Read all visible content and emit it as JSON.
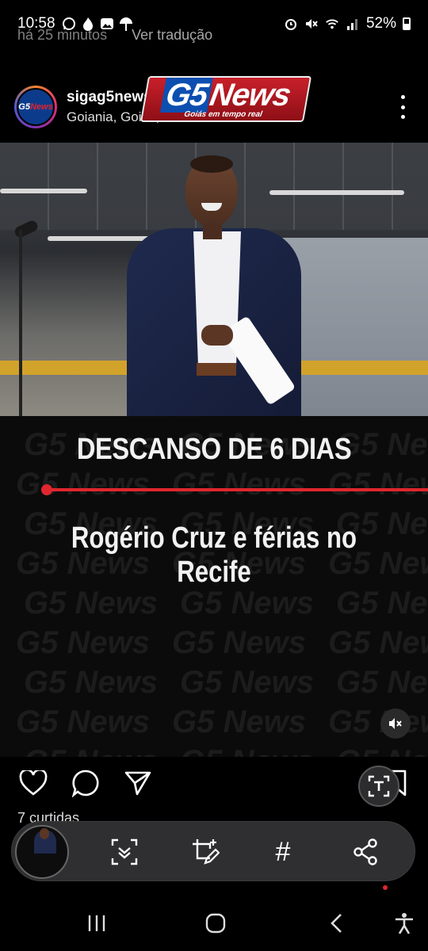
{
  "status_bar": {
    "time": "10:58",
    "battery": "52%",
    "left_icons": [
      "whatsapp-icon",
      "flame-icon",
      "gallery-icon",
      "pinwheel-icon"
    ],
    "right_icons": [
      "alarm-icon",
      "mute-icon",
      "wifi-icon",
      "signal-icon",
      "battery-icon"
    ]
  },
  "previous_comment": {
    "time_ago": "há 25 minutos",
    "translate": "Ver tradução"
  },
  "post": {
    "username": "sigag5news",
    "location": "Goiania, Goiás, Brasil",
    "avatar_text_a": "G5",
    "avatar_text_b": "News",
    "logo_main_a": "G5",
    "logo_main_b": "News",
    "logo_subtitle": "Goiás em tempo real",
    "watermark": "G5 News",
    "headline": "DESCANSO DE 6 DIAS",
    "subheadline": "Rogério Cruz e férias no Recife",
    "likes": "7 curtidas"
  },
  "colors": {
    "accent_red": "#e0262e",
    "brand_blue": "#0d4fb0",
    "background": "#000000",
    "toolbar": "#2f2f31"
  },
  "actions": [
    "heart-icon",
    "comment-icon",
    "share-icon",
    "text-scan-icon",
    "save-icon"
  ],
  "toolbar_actions": [
    "smart-select-icon",
    "crop-edit-icon",
    "hashtag-icon",
    "share-icon"
  ],
  "toolbar_hash": "#",
  "nav": [
    "recents-icon",
    "home-icon",
    "back-icon",
    "accessibility-icon"
  ]
}
